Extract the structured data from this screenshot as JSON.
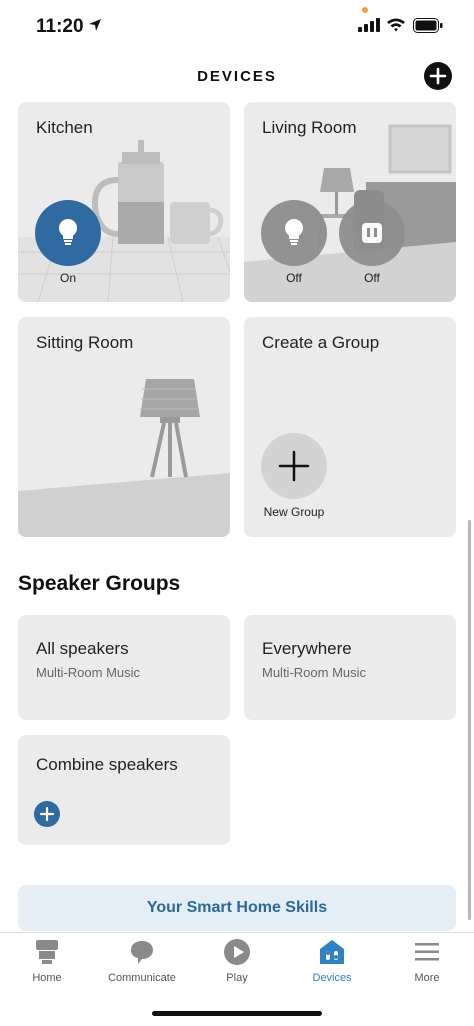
{
  "status": {
    "time": "11:20"
  },
  "header": {
    "title": "DEVICES"
  },
  "groups": [
    {
      "name": "Kitchen",
      "devices": [
        {
          "state": "On"
        }
      ]
    },
    {
      "name": "Living Room",
      "devices": [
        {
          "state": "Off"
        },
        {
          "state": "Off"
        }
      ]
    },
    {
      "name": "Sitting Room"
    },
    {
      "name": "Create a Group",
      "action": "New Group"
    }
  ],
  "speaker_groups": {
    "title": "Speaker Groups",
    "items": [
      {
        "name": "All speakers",
        "sub": "Multi-Room Music"
      },
      {
        "name": "Everywhere",
        "sub": "Multi-Room Music"
      },
      {
        "name": "Combine speakers"
      }
    ]
  },
  "skills_banner": "Your Smart Home Skills",
  "tabs": [
    {
      "label": "Home",
      "icon": "home-icon"
    },
    {
      "label": "Communicate",
      "icon": "chat-icon"
    },
    {
      "label": "Play",
      "icon": "play-icon"
    },
    {
      "label": "Devices",
      "icon": "devices-icon",
      "active": true
    },
    {
      "label": "More",
      "icon": "menu-icon"
    }
  ],
  "colors": {
    "accent": "#2f6aa1",
    "active_tab": "#2f83c5",
    "card": "#ebebeb"
  }
}
